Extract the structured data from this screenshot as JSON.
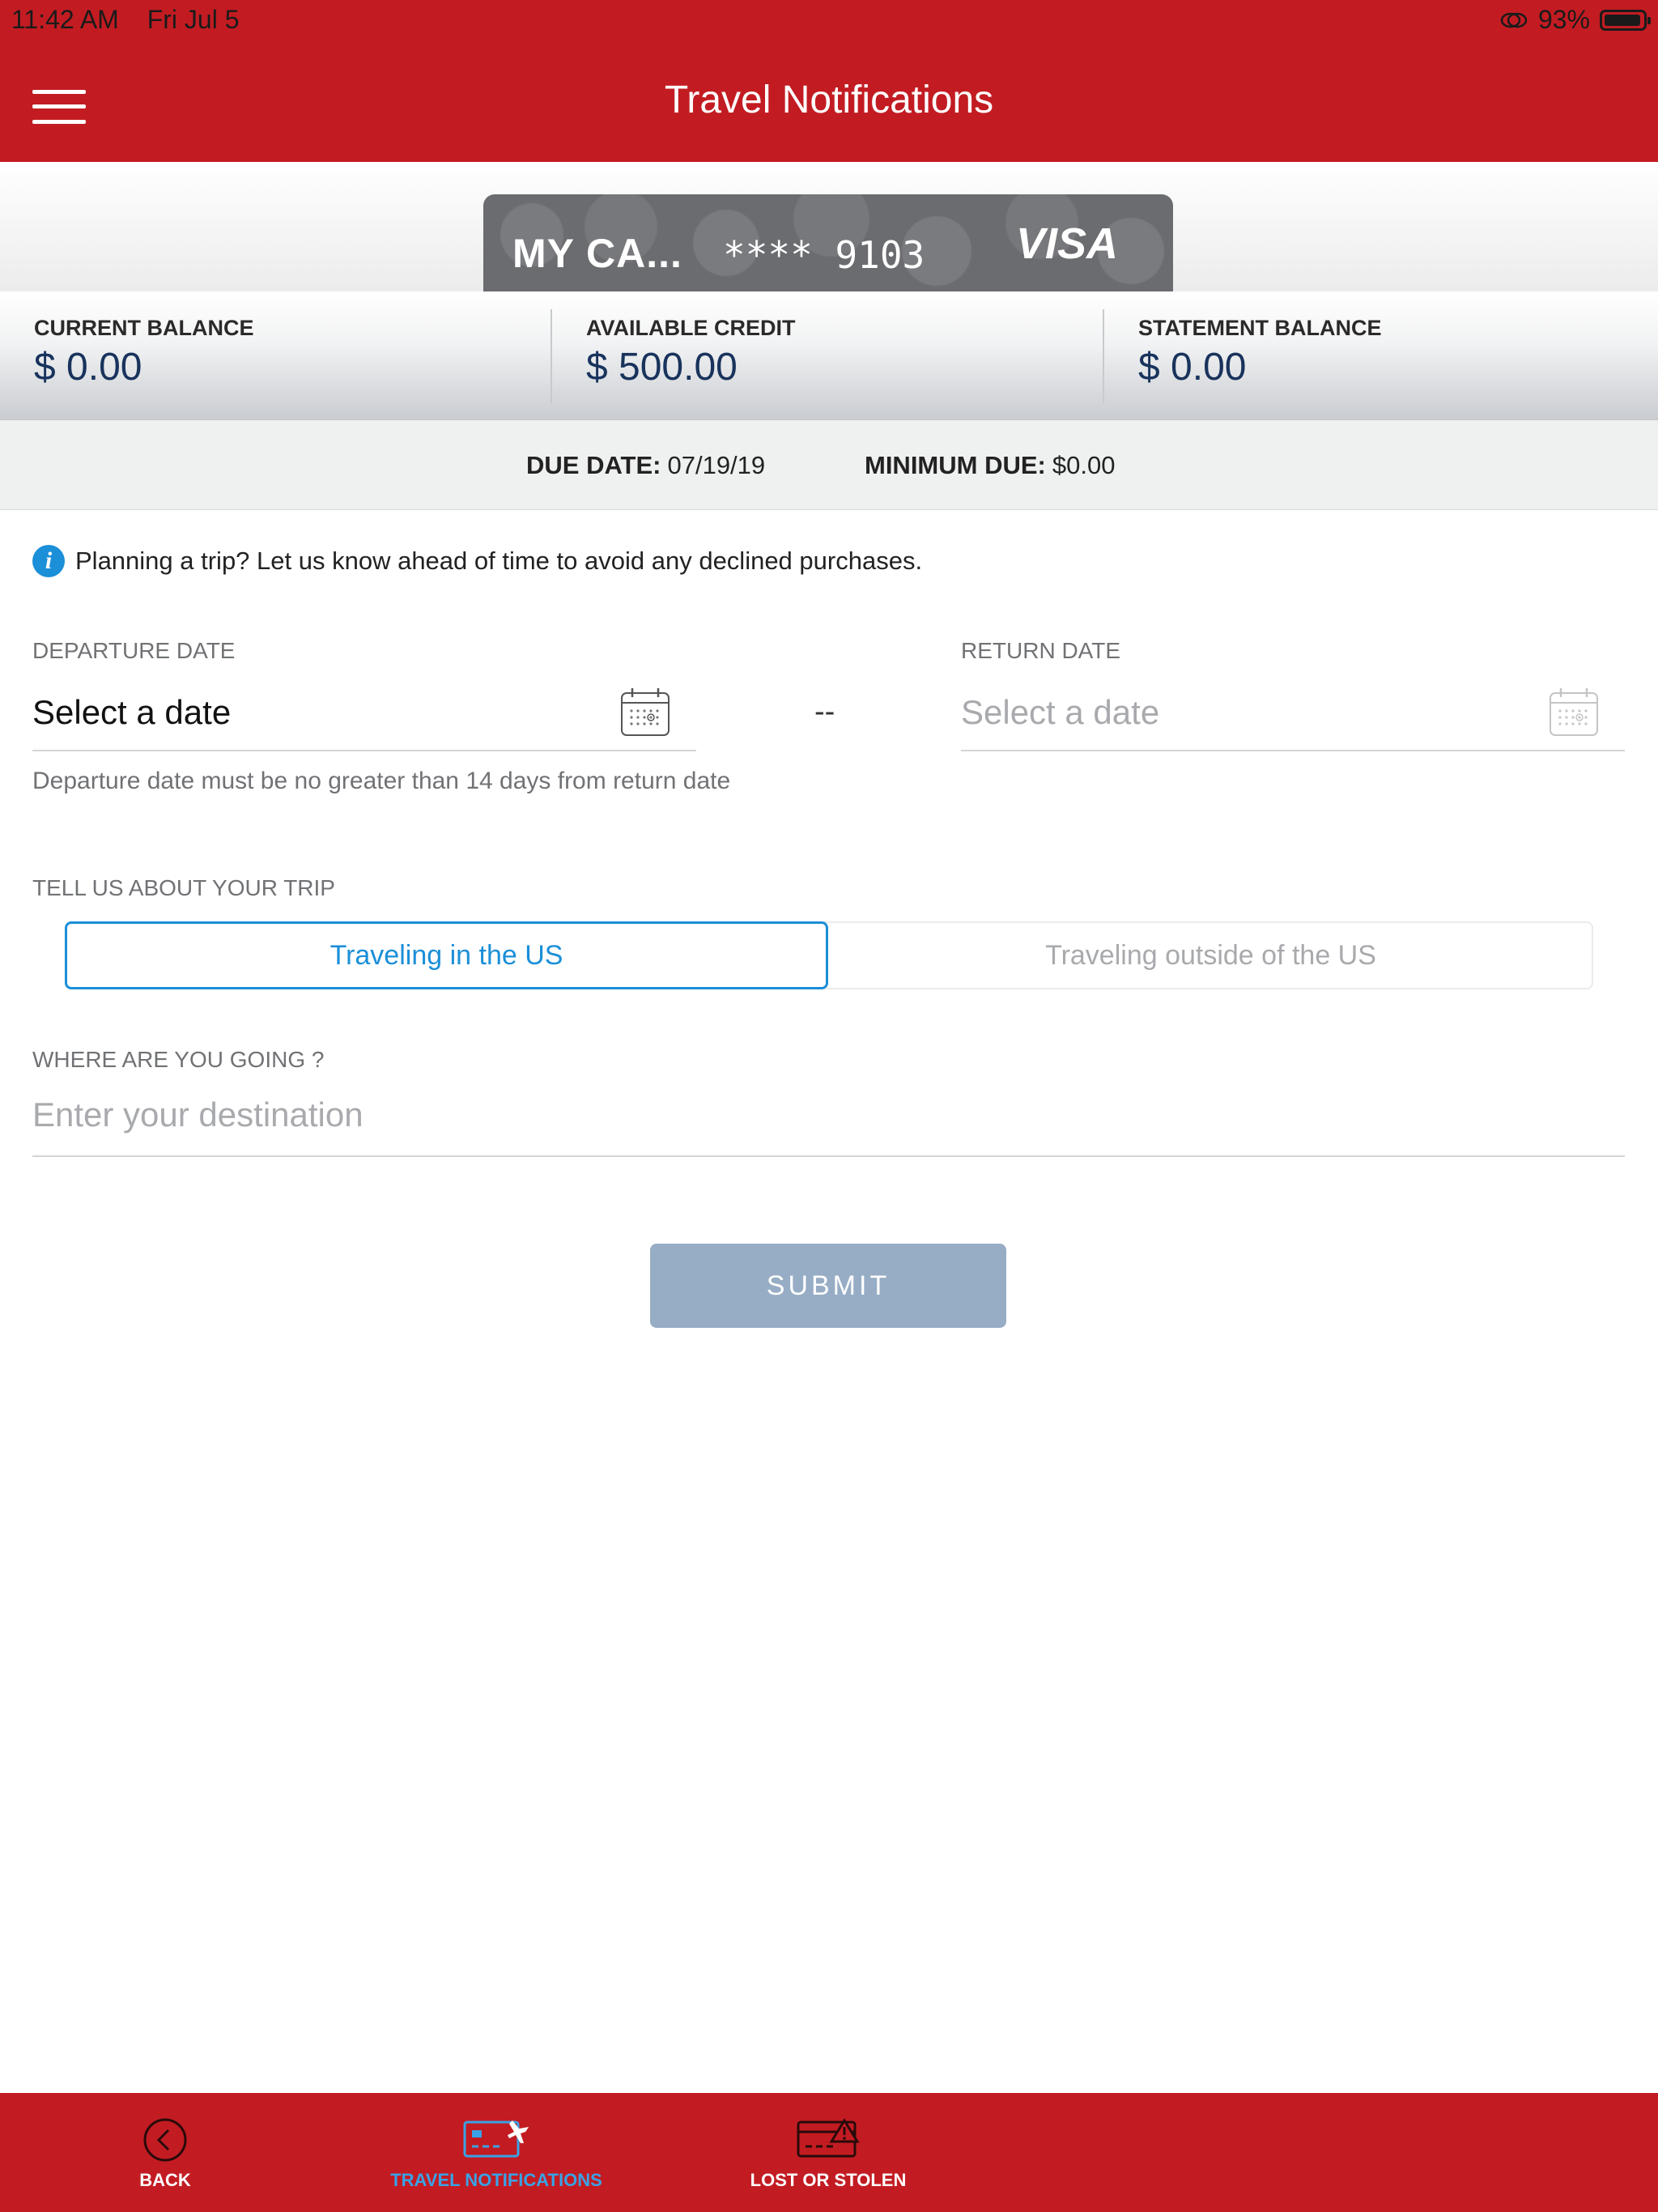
{
  "status_bar": {
    "time": "11:42 AM",
    "date": "Fri Jul 5",
    "battery": "93%",
    "battery_level": 0.93
  },
  "header": {
    "title": "Travel Notifications",
    "menu_icon": "hamburger-menu-icon",
    "background_color": "#c21c22"
  },
  "card": {
    "name": "MY CA...",
    "number_masked": "**** 9103",
    "brand": "VISA"
  },
  "balances": [
    {
      "label": "CURRENT BALANCE",
      "value": "$ 0.00"
    },
    {
      "label": "AVAILABLE CREDIT",
      "value": "$ 500.00"
    },
    {
      "label": "STATEMENT BALANCE",
      "value": "$ 0.00"
    }
  ],
  "due": {
    "due_date_label": "DUE DATE:",
    "due_date_value": "07/19/19",
    "minimum_due_label": "MINIMUM DUE:",
    "minimum_due_value": "$0.00"
  },
  "info": {
    "icon": "info-icon",
    "text": "Planning a trip? Let us know ahead of time to avoid any declined purchases."
  },
  "dates": {
    "departure_label": "DEPARTURE DATE",
    "departure_value": "Select a date",
    "separator": "--",
    "return_label": "RETURN DATE",
    "return_placeholder": "Select a date",
    "hint": "Departure date must be no greater than 14 days from return date"
  },
  "trip": {
    "label": "TELL US ABOUT YOUR TRIP",
    "options": [
      {
        "label": "Traveling in the US",
        "selected": true
      },
      {
        "label": "Traveling outside of the US",
        "selected": false
      }
    ]
  },
  "destination": {
    "label": "WHERE ARE YOU GOING ?",
    "placeholder": "Enter your destination"
  },
  "submit_label": "SUBMIT",
  "tabs": [
    {
      "label": "BACK",
      "icon": "back-circle-icon",
      "active": false
    },
    {
      "label": "TRAVEL NOTIFICATIONS",
      "icon": "card-plane-icon",
      "active": true
    },
    {
      "label": "LOST OR STOLEN",
      "icon": "card-warning-icon",
      "active": false
    }
  ],
  "colors": {
    "brand_red": "#c21c22",
    "accent_blue": "#1b8fd8",
    "balance_text": "#18335c",
    "submit_disabled": "#97adc5"
  }
}
